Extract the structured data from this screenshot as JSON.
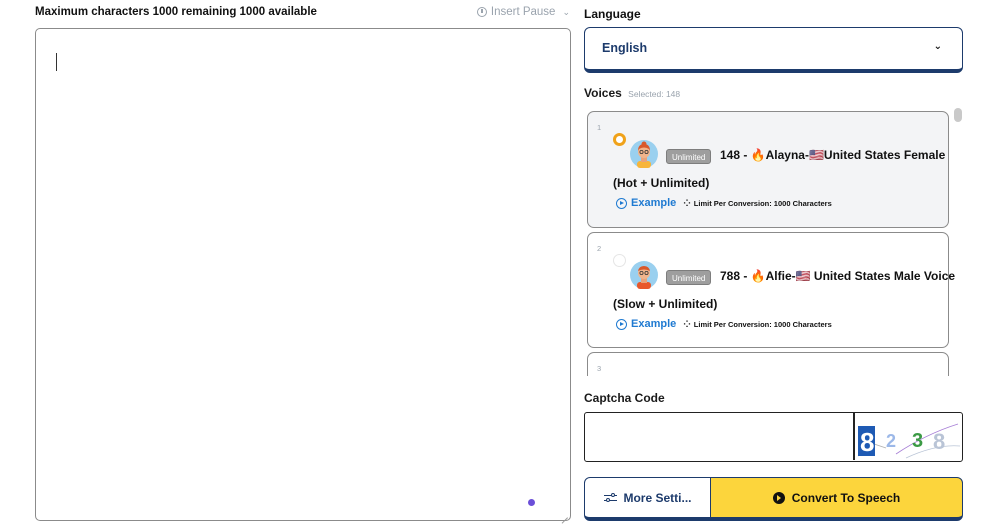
{
  "editor": {
    "char_info": "Maximum characters 1000 remaining 1000 available",
    "insert_pause_label": "Insert Pause",
    "text": ""
  },
  "language": {
    "label": "Language",
    "selected": "English"
  },
  "voices": {
    "label": "Voices",
    "selected_text": "Selected: 148",
    "items": [
      {
        "index": "1",
        "selected": true,
        "badge": "Unlimited",
        "title": "148 - 🔥Alayna-🇺🇸United States Female",
        "subtitle": "(Hot + Unlimited)",
        "example_label": "Example",
        "limit_text": "Limit Per Conversion: 1000 Characters"
      },
      {
        "index": "2",
        "selected": false,
        "badge": "Unlimited",
        "title": "788 - 🔥Alfie-🇺🇸 United States Male Voice",
        "subtitle": "(Slow + Unlimited)",
        "example_label": "Example",
        "limit_text": "Limit Per Conversion: 1000 Characters"
      },
      {
        "index": "3"
      }
    ]
  },
  "captcha": {
    "label": "Captcha Code",
    "value": "",
    "image_text": "8 2 3 8"
  },
  "actions": {
    "more_settings": "More Setti...",
    "convert": "Convert To Speech"
  },
  "colors": {
    "navy": "#1d3b6c",
    "accent_yellow": "#fcd53c",
    "link_blue": "#1f7ad1",
    "radio_orange": "#f0a21a"
  }
}
